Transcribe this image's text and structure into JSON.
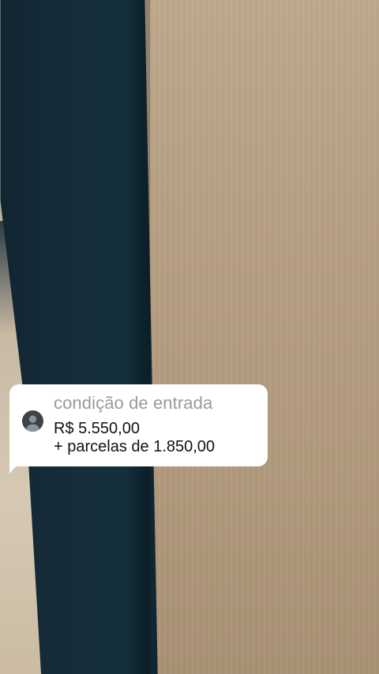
{
  "message": {
    "title": "condição de entrada",
    "line1": "R$ 5.550,00",
    "line2": "+ parcelas de 1.850,00",
    "avatar_icon": "user-avatar-icon"
  },
  "colors": {
    "bubble_bg": "#ffffff",
    "title_text": "#9a9a9a",
    "body_text": "#111111",
    "door": "#162c38",
    "wood": "#b7a083"
  }
}
